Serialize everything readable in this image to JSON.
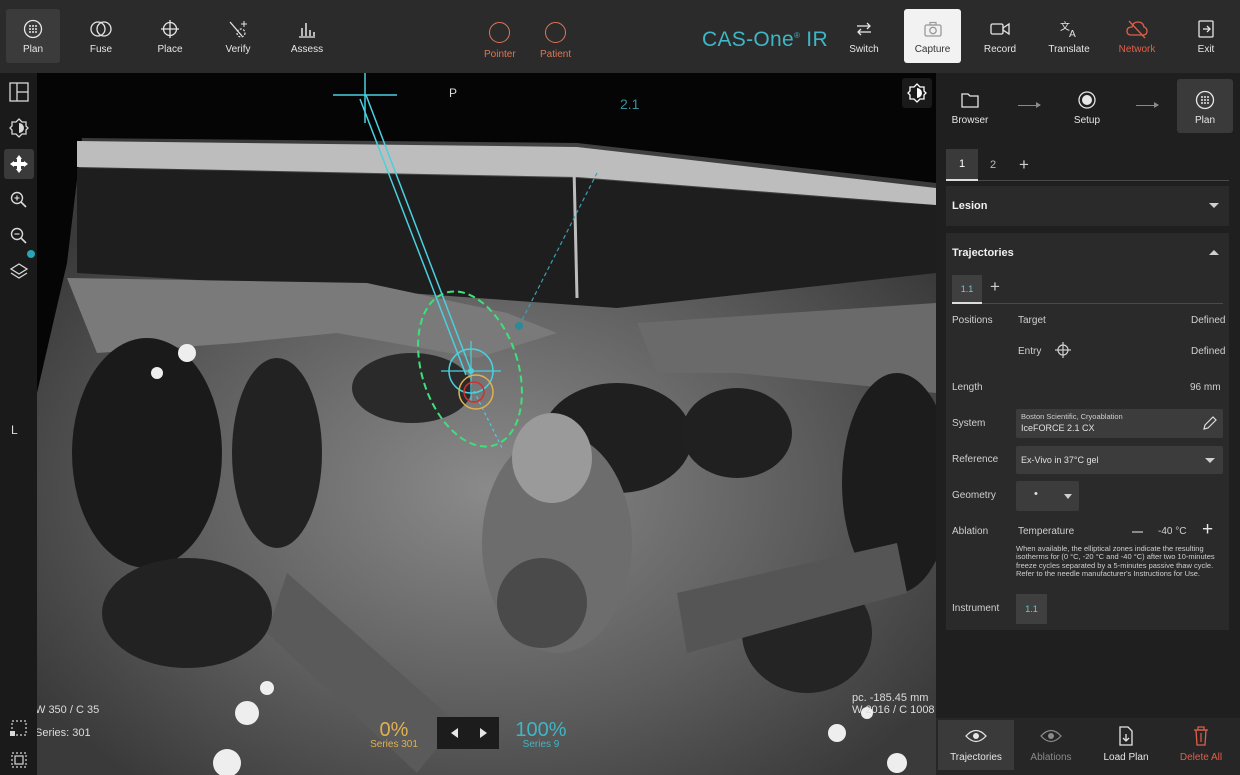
{
  "toolbar": {
    "left_items": [
      {
        "label": "Plan",
        "icon": "plan-icon"
      },
      {
        "label": "Fuse",
        "icon": "fuse-icon"
      },
      {
        "label": "Place",
        "icon": "crosshair-icon"
      },
      {
        "label": "Verify",
        "icon": "verify-icon"
      },
      {
        "label": "Assess",
        "icon": "bar-chart-icon"
      }
    ],
    "pointer_label": "Pointer",
    "patient_label": "Patient",
    "brand_name": "CAS-One",
    "brand_mark": "®",
    "brand_suffix": " IR",
    "right_items": [
      {
        "label": "Switch",
        "icon": "swap-icon"
      },
      {
        "label": "Capture",
        "icon": "camera-icon"
      },
      {
        "label": "Record",
        "icon": "video-icon"
      },
      {
        "label": "Translate",
        "icon": "translate-icon"
      },
      {
        "label": "Network",
        "icon": "cloud-off-icon"
      },
      {
        "label": "Exit",
        "icon": "exit-icon"
      }
    ],
    "accent_color": "#3fb6c5",
    "warning_color": "#e0604a"
  },
  "viewer": {
    "orientation_top": "P",
    "orientation_left": "L",
    "trajectory_label": "2.1",
    "window_level_left": "W 350 / C 35",
    "series_left": "Series: 301",
    "position_right": "pc. -185.45 mm",
    "window_level_right": "W 2016 / C 1008",
    "blend_left_pct": "0%",
    "blend_left_series": "Series 301",
    "blend_right_pct": "100%",
    "blend_right_series": "Series 9"
  },
  "panel": {
    "workflow": [
      {
        "label": "Browser",
        "icon": "folder-icon"
      },
      {
        "label": "Setup",
        "icon": "setup-icon"
      },
      {
        "label": "Plan",
        "icon": "plan-icon"
      }
    ],
    "tabs": [
      "1",
      "2"
    ],
    "lesion_title": "Lesion",
    "trajectories_title": "Trajectories",
    "trajectory_tab": "1.1",
    "positions_label": "Positions",
    "target_label": "Target",
    "target_state": "Defined",
    "entry_label": "Entry",
    "entry_state": "Defined",
    "length_label": "Length",
    "length_value": "96 mm",
    "system_label": "System",
    "system_line1": "Boston Scientific, Cryoablation",
    "system_line2": "IceFORCE 2.1 CX",
    "reference_label": "Reference",
    "reference_value": "Ex-Vivo in 37°C gel",
    "geometry_label": "Geometry",
    "geometry_value": "•",
    "ablation_label": "Ablation",
    "temperature_label": "Temperature",
    "temperature_value": "-40 °C",
    "ablation_note": "When available, the elliptical zones indicate the resulting isotherms for (0 °C, -20 °C and -40 °C) after two 10-minutes freeze cycles separated by a 5-minutes passive thaw cycle. Refer to the needle manufacturer's Instructions for Use.",
    "instrument_label": "Instrument",
    "instrument_value": "1.1",
    "bottom": [
      {
        "label": "Trajectories",
        "icon": "eye-icon"
      },
      {
        "label": "Ablations",
        "icon": "eye-icon"
      },
      {
        "label": "Load Plan",
        "icon": "load-file-icon"
      },
      {
        "label": "Delete All",
        "icon": "trash-icon"
      }
    ]
  }
}
